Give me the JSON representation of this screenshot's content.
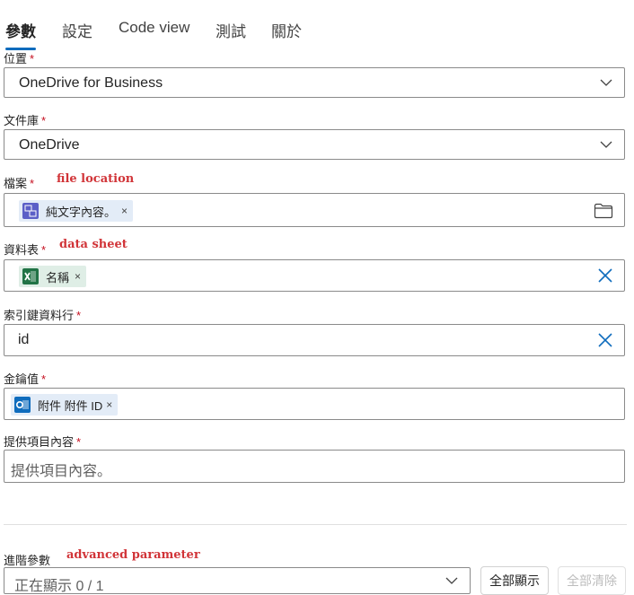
{
  "tabs": [
    {
      "label": "參數"
    },
    {
      "label": "設定"
    },
    {
      "label": "Code view"
    },
    {
      "label": "測試"
    },
    {
      "label": "關於"
    }
  ],
  "required_mark": "*",
  "fields": {
    "location": {
      "label": "位置",
      "value": "OneDrive for Business"
    },
    "library": {
      "label": "文件庫",
      "value": "OneDrive"
    },
    "file": {
      "label": "檔案",
      "annotation": "file location",
      "token": "純文字內容。",
      "token_remove": "×",
      "icon": "folder-icon"
    },
    "table": {
      "label": "資料表",
      "annotation": "data sheet",
      "token": "名稱",
      "token_remove": "×"
    },
    "key_column": {
      "label": "索引鍵資料行",
      "value": "id"
    },
    "key_value": {
      "label": "金鑰值",
      "token": "附件 附件 ID",
      "token_remove": "×"
    },
    "provide_item": {
      "label": "提供項目內容",
      "placeholder": "提供項目內容。"
    }
  },
  "advanced": {
    "label": "進階參數",
    "annotation": "advanced parameter",
    "select_value": "正在顯示 0 / 1",
    "show_all": "全部顯示",
    "clear_all": "全部清除"
  },
  "colors": {
    "accent": "#0f6cbd",
    "required": "#c50f1f",
    "annotation": "#d13438",
    "excel": "#217346",
    "outlook": "#0f6cbd"
  }
}
